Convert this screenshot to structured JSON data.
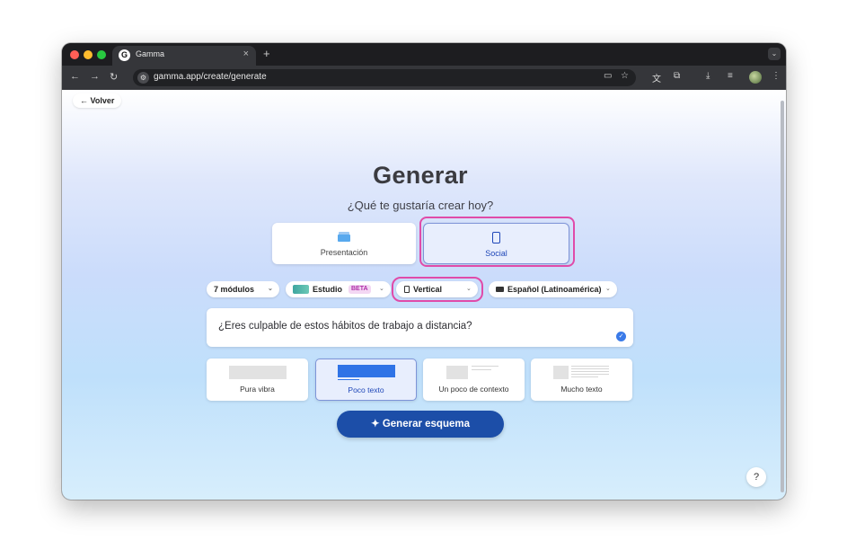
{
  "browser": {
    "tab_title": "Gamma",
    "tab_favicon": "G",
    "url": "gamma.app/create/generate",
    "icons": [
      "back-arrow-icon",
      "forward-arrow-icon",
      "reload-icon",
      "site-settings-icon",
      "cast-icon",
      "bookmark-star-icon",
      "translate-icon",
      "extensions-icon",
      "download-icon",
      "reading-list-icon",
      "profile-avatar",
      "menu-kebab-icon"
    ]
  },
  "page": {
    "back_label": "← Volver",
    "title": "Generar",
    "subtitle": "¿Qué te gustaría crear hoy?",
    "content_types": [
      {
        "label": "Presentación",
        "icon": "presentation-icon"
      },
      {
        "label": "Social",
        "icon": "phone-icon",
        "selected": true
      }
    ],
    "options": {
      "modules": "7 módulos",
      "theme": "Estudio",
      "theme_badge": "BETA",
      "orientation": "Vertical",
      "language": "Español (Latinoamérica)"
    },
    "prompt": "¿Eres culpable de estos hábitos de trabajo a distancia?",
    "text_density": [
      {
        "label": "Pura vibra"
      },
      {
        "label": "Poco texto",
        "selected": true
      },
      {
        "label": "Un poco de contexto"
      },
      {
        "label": "Mucho texto"
      }
    ],
    "generate_button": "✦ Generar esquema",
    "help_label": "?"
  },
  "colors": {
    "accent": "#1c4ea8",
    "selected_border": "#7e94d8",
    "highlight": "#e04ba9",
    "beta_badge": "#b02ea8"
  }
}
